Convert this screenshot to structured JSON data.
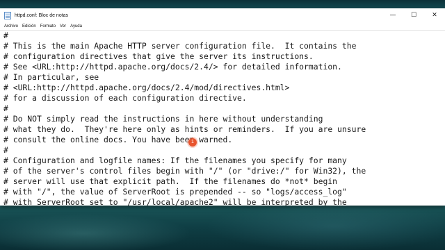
{
  "window": {
    "title": "httpd.conf: Bloc de notas",
    "controls": {
      "minimize": "—",
      "maximize": "☐",
      "close": "✕"
    }
  },
  "menu": {
    "items": [
      "Archivo",
      "Edición",
      "Formato",
      "Ver",
      "Ayuda"
    ]
  },
  "editor": {
    "lines": [
      "#",
      "# This is the main Apache HTTP server configuration file.  It contains the",
      "# configuration directives that give the server its instructions.",
      "# See <URL:http://httpd.apache.org/docs/2.4/> for detailed information.",
      "# In particular, see",
      "# <URL:http://httpd.apache.org/docs/2.4/mod/directives.html>",
      "# for a discussion of each configuration directive.",
      "#",
      "# Do NOT simply read the instructions in here without understanding",
      "# what they do.  They're here only as hints or reminders.  If you are unsure",
      "# consult the online docs. You have been warned.",
      "#",
      "# Configuration and logfile names: If the filenames you specify for many",
      "# of the server's control files begin with \"/\" (or \"drive:/\" for Win32), the",
      "# server will use that explicit path.  If the filenames do *not* begin",
      "# with \"/\", the value of ServerRoot is prepended -- so \"logs/access_log\"",
      "# with ServerRoot set to \"/usr/local/apache2\" will be interpreted by the"
    ]
  },
  "click_marker": {
    "label": "1",
    "color": "#e8542e"
  }
}
